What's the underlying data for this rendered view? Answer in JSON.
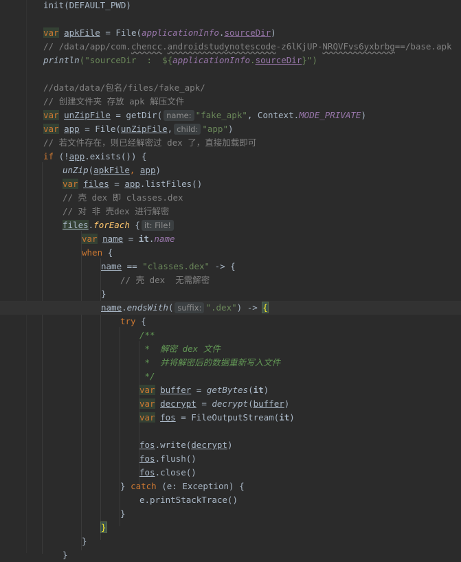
{
  "code": {
    "l01": "init(DEFAULT_PWD)",
    "l03_var": "var",
    "l03_name": "apkFile",
    "l03_eq": " = File(",
    "l03_arg": "applicationInfo",
    "l03_dot": ".",
    "l03_prop": "sourceDir",
    "l03_end": ")",
    "l04_a": "// /data/app/com.",
    "l04_b": "chencc",
    "l04_c": ".",
    "l04_d": "androidstudynotescode",
    "l04_e": "-z6lKjUP-",
    "l04_f": "NRQVFvs6yxbrbg",
    "l04_g": "==/base.apk",
    "l05_fn": "println",
    "l05_str1": "(\"sourceDir  :  ${",
    "l05_arg": "applicationInfo",
    "l05_dot": ".",
    "l05_prop": "sourceDir",
    "l05_str2": "}\")",
    "l07": "//data/data/包名/files/fake_apk/",
    "l08": "// 创建文件夹 存放 apk 解压文件",
    "l09_var": "var",
    "l09_name": "unZipFile",
    "l09_eq": " = getDir(",
    "l09_hint": "name:",
    "l09_str": "\"fake_apk\"",
    "l09_mid": ", Context.",
    "l09_const": "MODE_PRIVATE",
    "l09_end": ")",
    "l10_var": "var",
    "l10_name": "app",
    "l10_eq": " = File(",
    "l10_arg": "unZipFile",
    "l10_comma": ",",
    "l10_hint": "child:",
    "l10_str": "\"app\"",
    "l10_end": ")",
    "l11": "// 若文件存在，则已经解密过 dex 了，直接加载即可",
    "l12_if": "if",
    "l12_a": " (!",
    "l12_app": "app",
    "l12_b": ".exists()) {",
    "l13_fn": "unZip",
    "l13_a": "(",
    "l13_b": "apkFile",
    "l13_c": ", ",
    "l13_d": "app",
    "l13_e": ")",
    "l14_var": "var",
    "l14_name": "files",
    "l14_eq": " = ",
    "l14_app": "app",
    "l14_end": ".listFiles()",
    "l15": "// 壳 dex 即 classes.dex",
    "l16": "// 对 非 壳dex 进行解密",
    "l17_files": "files",
    "l17_dot": ".",
    "l17_fn": "forEach",
    "l17_brace": " {",
    "l17_hint": "it: File!",
    "l18_var": "var",
    "l18_name": "name",
    "l18_eq": " = ",
    "l18_it": "it",
    "l18_dot": ".",
    "l18_prop": "name",
    "l19_when": "when",
    "l19_brace": " {",
    "l20_name": "name",
    "l20_eq": " == ",
    "l20_str": "\"classes.dex\"",
    "l20_arrow": " -> {",
    "l21": "// 壳 dex  无需解密",
    "l22": "}",
    "l23_name": "name",
    "l23_dot": ".",
    "l23_fn": "endsWith",
    "l23_open": "(",
    "l23_hint": "suffix:",
    "l23_str": "\".dex\"",
    "l23_arrow": ") -> ",
    "l23_brace": "{",
    "l24_try": "try",
    "l24_brace": " {",
    "l25": "/**",
    "l26": " *  解密 dex 文件",
    "l27": " *  并将解密后的数据重新写入文件",
    "l28": " */",
    "l29_var": "var",
    "l29_name": "buffer",
    "l29_eq": " = ",
    "l29_fn": "getBytes",
    "l29_a": "(",
    "l29_it": "it",
    "l29_b": ")",
    "l30_var": "var",
    "l30_name": "decrypt",
    "l30_eq": " = ",
    "l30_fn": "decrypt",
    "l30_a": "(",
    "l30_arg": "buffer",
    "l30_b": ")",
    "l31_var": "var",
    "l31_name": "fos",
    "l31_eq": " = FileOutputStream(",
    "l31_it": "it",
    "l31_b": ")",
    "l33_fos": "fos",
    "l33_a": ".write(",
    "l33_arg": "decrypt",
    "l33_b": ")",
    "l34_fos": "fos",
    "l34_a": ".flush()",
    "l35_fos": "fos",
    "l35_a": ".close()",
    "l36_a": "} ",
    "l36_catch": "catch",
    "l36_b": " (e: Exception) {",
    "l37": "e.printStackTrace()",
    "l38": "}",
    "l39": "}",
    "l40": "}",
    "l41": "}"
  },
  "colors": {
    "background": "#2b2b2b",
    "keyword": "#cc7832",
    "string": "#6a8759",
    "comment": "#808080",
    "doc_comment": "#629755",
    "property": "#9876aa"
  }
}
